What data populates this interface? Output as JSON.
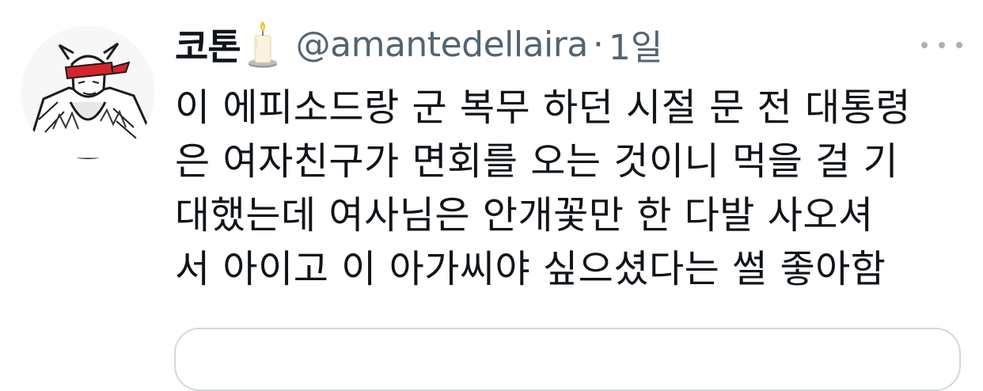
{
  "tweet": {
    "author": {
      "display_name": "코톤",
      "emoji": "candle-icon",
      "handle": "@amantedellaira",
      "avatar": "avatar-illustration"
    },
    "separator": "·",
    "time": "1일",
    "more_icon": "more-horizontal-icon",
    "text_lines": [
      "이 에피소드랑 군 복무 하던 시절 문 전 대통령",
      "은 여자친구가 면회를 오는 것이니 먹을 걸 기",
      "대했는데 여사님은 안개꽃만 한 다발 사오셔",
      "서 아이고 이 아가씨야 싶으셨다는 썰 좋아함"
    ]
  },
  "colors": {
    "text_primary": "#0f1419",
    "text_secondary": "#536471",
    "card_border": "#cfd9de",
    "avatar_accent": "#d7232a"
  }
}
